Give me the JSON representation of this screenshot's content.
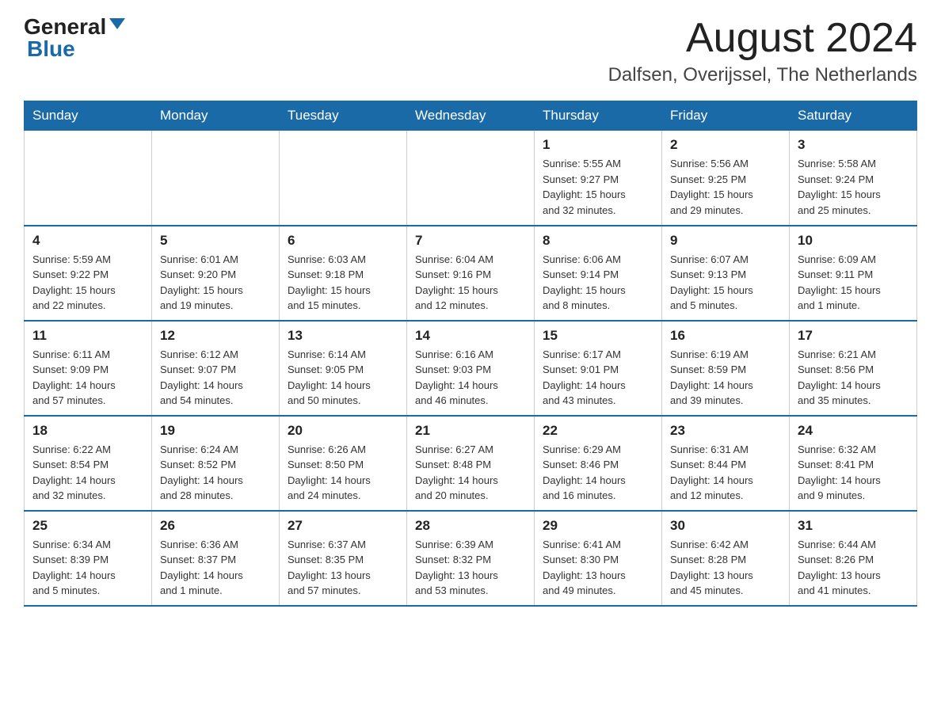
{
  "header": {
    "logo_general": "General",
    "logo_blue": "Blue",
    "month_title": "August 2024",
    "location": "Dalfsen, Overijssel, The Netherlands"
  },
  "days_of_week": [
    "Sunday",
    "Monday",
    "Tuesday",
    "Wednesday",
    "Thursday",
    "Friday",
    "Saturday"
  ],
  "weeks": [
    [
      {
        "day": "",
        "info": ""
      },
      {
        "day": "",
        "info": ""
      },
      {
        "day": "",
        "info": ""
      },
      {
        "day": "",
        "info": ""
      },
      {
        "day": "1",
        "info": "Sunrise: 5:55 AM\nSunset: 9:27 PM\nDaylight: 15 hours\nand 32 minutes."
      },
      {
        "day": "2",
        "info": "Sunrise: 5:56 AM\nSunset: 9:25 PM\nDaylight: 15 hours\nand 29 minutes."
      },
      {
        "day": "3",
        "info": "Sunrise: 5:58 AM\nSunset: 9:24 PM\nDaylight: 15 hours\nand 25 minutes."
      }
    ],
    [
      {
        "day": "4",
        "info": "Sunrise: 5:59 AM\nSunset: 9:22 PM\nDaylight: 15 hours\nand 22 minutes."
      },
      {
        "day": "5",
        "info": "Sunrise: 6:01 AM\nSunset: 9:20 PM\nDaylight: 15 hours\nand 19 minutes."
      },
      {
        "day": "6",
        "info": "Sunrise: 6:03 AM\nSunset: 9:18 PM\nDaylight: 15 hours\nand 15 minutes."
      },
      {
        "day": "7",
        "info": "Sunrise: 6:04 AM\nSunset: 9:16 PM\nDaylight: 15 hours\nand 12 minutes."
      },
      {
        "day": "8",
        "info": "Sunrise: 6:06 AM\nSunset: 9:14 PM\nDaylight: 15 hours\nand 8 minutes."
      },
      {
        "day": "9",
        "info": "Sunrise: 6:07 AM\nSunset: 9:13 PM\nDaylight: 15 hours\nand 5 minutes."
      },
      {
        "day": "10",
        "info": "Sunrise: 6:09 AM\nSunset: 9:11 PM\nDaylight: 15 hours\nand 1 minute."
      }
    ],
    [
      {
        "day": "11",
        "info": "Sunrise: 6:11 AM\nSunset: 9:09 PM\nDaylight: 14 hours\nand 57 minutes."
      },
      {
        "day": "12",
        "info": "Sunrise: 6:12 AM\nSunset: 9:07 PM\nDaylight: 14 hours\nand 54 minutes."
      },
      {
        "day": "13",
        "info": "Sunrise: 6:14 AM\nSunset: 9:05 PM\nDaylight: 14 hours\nand 50 minutes."
      },
      {
        "day": "14",
        "info": "Sunrise: 6:16 AM\nSunset: 9:03 PM\nDaylight: 14 hours\nand 46 minutes."
      },
      {
        "day": "15",
        "info": "Sunrise: 6:17 AM\nSunset: 9:01 PM\nDaylight: 14 hours\nand 43 minutes."
      },
      {
        "day": "16",
        "info": "Sunrise: 6:19 AM\nSunset: 8:59 PM\nDaylight: 14 hours\nand 39 minutes."
      },
      {
        "day": "17",
        "info": "Sunrise: 6:21 AM\nSunset: 8:56 PM\nDaylight: 14 hours\nand 35 minutes."
      }
    ],
    [
      {
        "day": "18",
        "info": "Sunrise: 6:22 AM\nSunset: 8:54 PM\nDaylight: 14 hours\nand 32 minutes."
      },
      {
        "day": "19",
        "info": "Sunrise: 6:24 AM\nSunset: 8:52 PM\nDaylight: 14 hours\nand 28 minutes."
      },
      {
        "day": "20",
        "info": "Sunrise: 6:26 AM\nSunset: 8:50 PM\nDaylight: 14 hours\nand 24 minutes."
      },
      {
        "day": "21",
        "info": "Sunrise: 6:27 AM\nSunset: 8:48 PM\nDaylight: 14 hours\nand 20 minutes."
      },
      {
        "day": "22",
        "info": "Sunrise: 6:29 AM\nSunset: 8:46 PM\nDaylight: 14 hours\nand 16 minutes."
      },
      {
        "day": "23",
        "info": "Sunrise: 6:31 AM\nSunset: 8:44 PM\nDaylight: 14 hours\nand 12 minutes."
      },
      {
        "day": "24",
        "info": "Sunrise: 6:32 AM\nSunset: 8:41 PM\nDaylight: 14 hours\nand 9 minutes."
      }
    ],
    [
      {
        "day": "25",
        "info": "Sunrise: 6:34 AM\nSunset: 8:39 PM\nDaylight: 14 hours\nand 5 minutes."
      },
      {
        "day": "26",
        "info": "Sunrise: 6:36 AM\nSunset: 8:37 PM\nDaylight: 14 hours\nand 1 minute."
      },
      {
        "day": "27",
        "info": "Sunrise: 6:37 AM\nSunset: 8:35 PM\nDaylight: 13 hours\nand 57 minutes."
      },
      {
        "day": "28",
        "info": "Sunrise: 6:39 AM\nSunset: 8:32 PM\nDaylight: 13 hours\nand 53 minutes."
      },
      {
        "day": "29",
        "info": "Sunrise: 6:41 AM\nSunset: 8:30 PM\nDaylight: 13 hours\nand 49 minutes."
      },
      {
        "day": "30",
        "info": "Sunrise: 6:42 AM\nSunset: 8:28 PM\nDaylight: 13 hours\nand 45 minutes."
      },
      {
        "day": "31",
        "info": "Sunrise: 6:44 AM\nSunset: 8:26 PM\nDaylight: 13 hours\nand 41 minutes."
      }
    ]
  ]
}
